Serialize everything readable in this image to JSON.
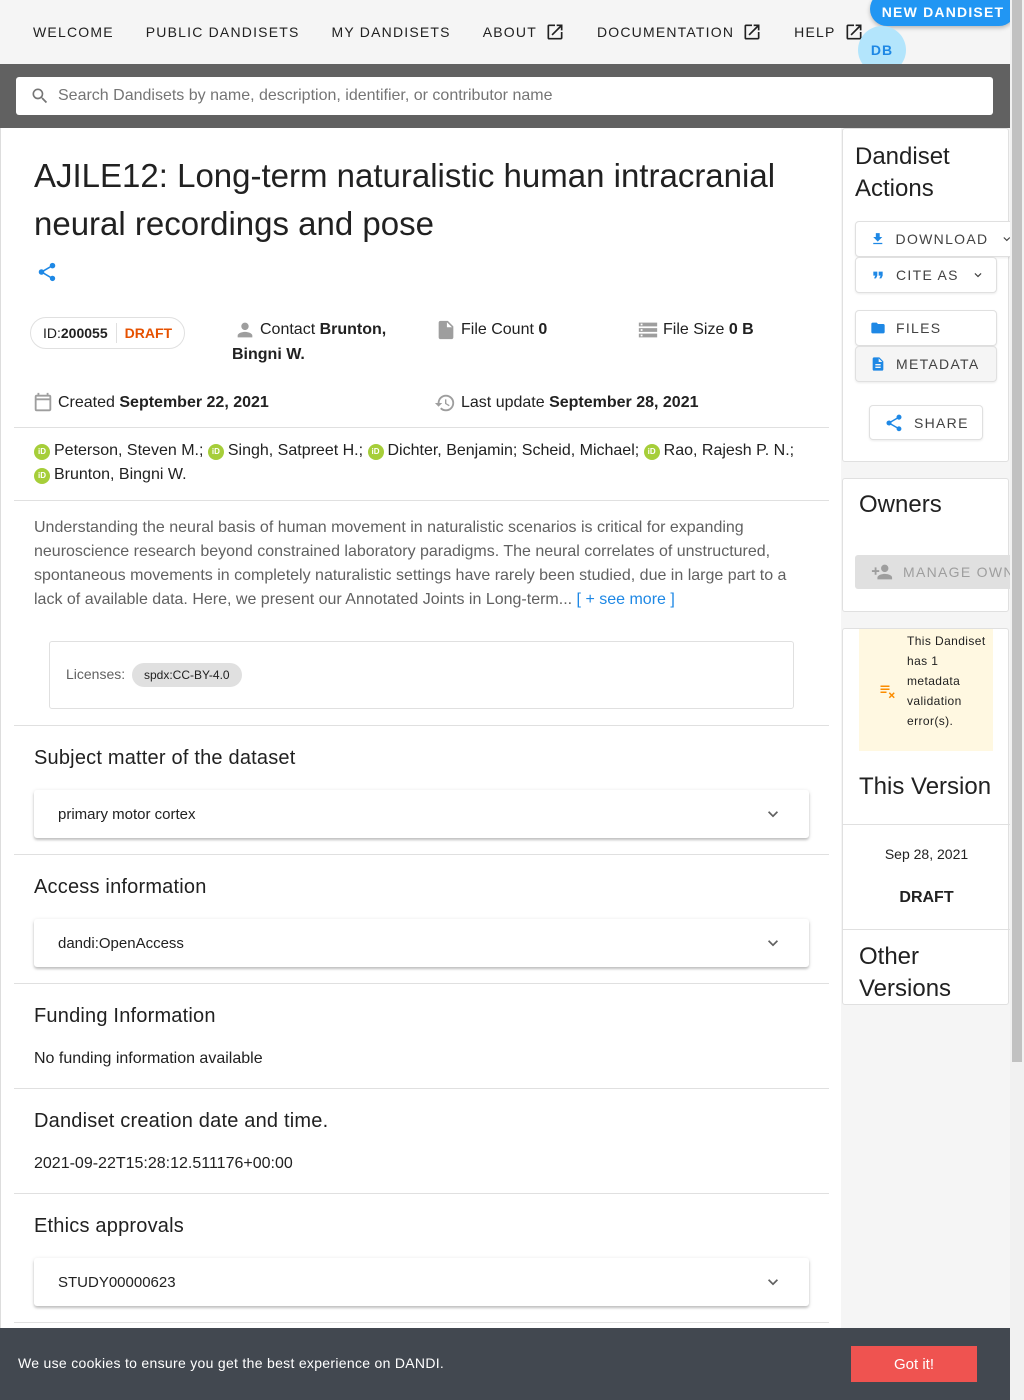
{
  "nav": {
    "items": [
      {
        "label": "WELCOME",
        "external": false
      },
      {
        "label": "PUBLIC DANDISETS",
        "external": false
      },
      {
        "label": "MY DANDISETS",
        "external": false
      },
      {
        "label": "ABOUT",
        "external": true
      },
      {
        "label": "DOCUMENTATION",
        "external": true
      },
      {
        "label": "HELP",
        "external": true
      }
    ],
    "new_dandiset": "NEW DANDISET",
    "avatar_initials": "DB"
  },
  "search": {
    "placeholder": "Search Dandisets by name, description, identifier, or contributor name"
  },
  "dandiset": {
    "title": "AJILE12: Long-term naturalistic human intracranial neural recordings and pose",
    "id_label": "ID:",
    "id": "200055",
    "status": "DRAFT",
    "contact_label": "Contact",
    "contact": "Brunton, Bingni W.",
    "file_count_label": "File Count",
    "file_count": "0",
    "file_size_label": "File Size",
    "file_size": "0 B",
    "created_label": "Created",
    "created": "September 22, 2021",
    "updated_label": "Last update",
    "updated": "September 28, 2021",
    "authors": [
      {
        "name": "Peterson, Steven M.;",
        "orcid": true
      },
      {
        "name": "Singh, Satpreet H.;",
        "orcid": true
      },
      {
        "name": "Dichter, Benjamin;",
        "orcid": true
      },
      {
        "name": "Scheid, Michael;",
        "orcid": false
      },
      {
        "name": "Rao, Rajesh P. N.;",
        "orcid": true
      },
      {
        "name": "Brunton, Bingni W.",
        "orcid": true
      }
    ],
    "description": "Understanding the neural basis of human movement in naturalistic scenarios is critical for expanding neuroscience research beyond constrained laboratory paradigms. The neural correlates of unstructured, spontaneous movements in completely naturalistic settings have rarely been studied, due in large part to a lack of available data. Here, we present our Annotated Joints in Long-term...",
    "see_more": "[ + see more ]",
    "licenses_label": "Licenses:",
    "license": "spdx:CC-BY-4.0"
  },
  "sections": {
    "subject": {
      "heading": "Subject matter of the dataset",
      "value": "primary motor cortex"
    },
    "access": {
      "heading": "Access information",
      "value": "dandi:OpenAccess"
    },
    "funding": {
      "heading": "Funding Information",
      "value": "No funding information available"
    },
    "creation": {
      "heading": "Dandiset creation date and time.",
      "value": "2021-09-22T15:28:12.511176+00:00"
    },
    "ethics": {
      "heading": "Ethics approvals",
      "value": "STUDY00000623"
    }
  },
  "sidebar": {
    "actions_title": "Dandiset Actions",
    "download": "DOWNLOAD",
    "cite_as": "CITE AS",
    "files": "FILES",
    "metadata": "METADATA",
    "share": "SHARE",
    "owners_title": "Owners",
    "manage_owners": "MANAGE OWNERS",
    "validation_warning": "This Dandiset has 1 metadata validation error(s).",
    "this_version_title": "This Version",
    "version_date": "Sep 28, 2021",
    "version_label": "DRAFT",
    "other_versions_title": "Other Versions"
  },
  "cookie": {
    "text": "We use cookies to ensure you get the best experience on DANDI.",
    "button": "Got it!"
  },
  "colors": {
    "primary": "#2196f3",
    "draft": "#e65100",
    "orcid": "#a6ce39",
    "cookie_button": "#ef5350",
    "warning_bg": "#fff8e1",
    "warning_icon": "#fb8c00"
  }
}
